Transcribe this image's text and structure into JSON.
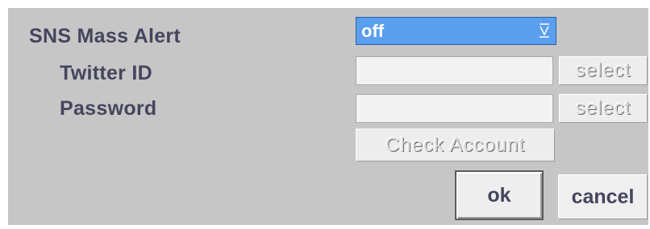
{
  "sns_mass_alert": {
    "label": "SNS Mass Alert",
    "selected_value": "off",
    "arrow_icon": "chevron-down-icon"
  },
  "twitter_id": {
    "label": "Twitter ID",
    "value": "",
    "select_label": "select"
  },
  "password": {
    "label": "Password",
    "value": "",
    "select_label": "select"
  },
  "check_account_label": "Check Account",
  "ok_label": "ok",
  "cancel_label": "cancel",
  "colors": {
    "panel_bg": "#c6c6c6",
    "label_text": "#45455e",
    "dropdown_bg": "#5a9fee"
  }
}
